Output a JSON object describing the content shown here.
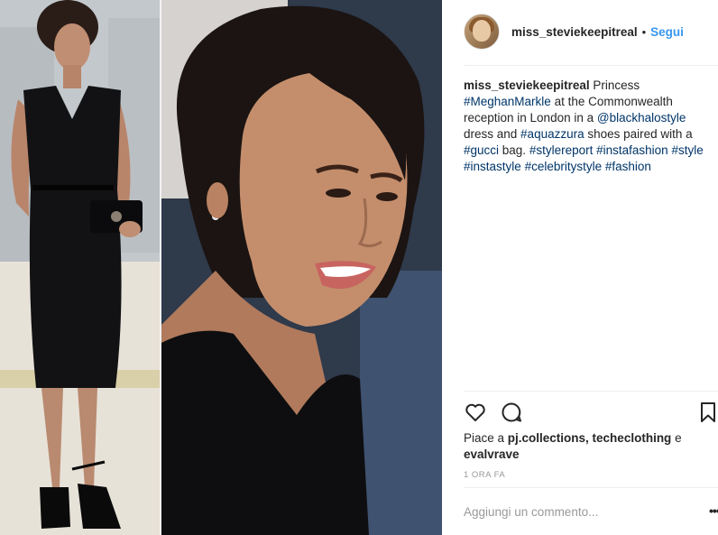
{
  "post": {
    "username": "miss_steviekeepitreal",
    "dot": "•",
    "follow_label": "Segui",
    "caption": {
      "user": "miss_steviekeepitreal",
      "t1": " Princess ",
      "h1": "#MeghanMarkle",
      "t2": " at the Commonwealth reception in London in a ",
      "m1": "@blackhalostyle",
      "t3": " dress and ",
      "h2": "#aquazzura",
      "t4": " shoes paired with a ",
      "h3": "#gucci",
      "t5": " bag. ",
      "h4": "#stylereport",
      "h5": "#instafashion",
      "h6": "#style",
      "h7": "#instastyle",
      "h8": "#celebritystyle",
      "h9": "#fashion"
    },
    "likes": {
      "prefix": "Piace a ",
      "users": "pj.collections, techeclothing",
      "conj": " e ",
      "last": "evalvrave"
    },
    "timestamp": "1 ORA FA",
    "comment_placeholder": "Aggiungi un commento...",
    "more_label": "•••"
  },
  "icons": {
    "like": "heart-icon",
    "comment": "comment-icon",
    "save": "bookmark-icon"
  },
  "colors": {
    "link": "#003569",
    "follow": "#3897f0",
    "muted": "#999999",
    "divider": "#efefef"
  }
}
